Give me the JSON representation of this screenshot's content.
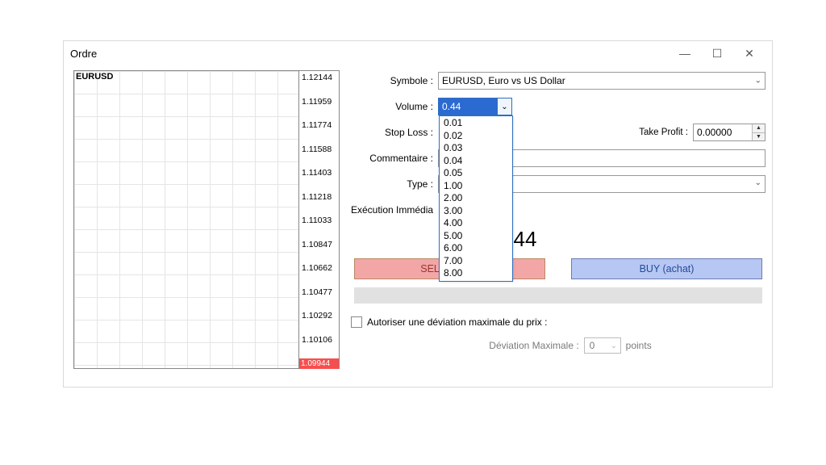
{
  "window": {
    "title": "Ordre"
  },
  "chart": {
    "symbol": "EURUSD",
    "ticks": [
      "1.12144",
      "1.11959",
      "1.11774",
      "1.11588",
      "1.11403",
      "1.11218",
      "1.11033",
      "1.10847",
      "1.10662",
      "1.10477",
      "1.10292",
      "1.10106"
    ],
    "current": "1.09944"
  },
  "form": {
    "labels": {
      "symbole": "Symbole :",
      "volume": "Volume :",
      "stoploss": "Stop Loss :",
      "takeprofit": "Take Profit :",
      "commentaire": "Commentaire :",
      "type": "Type :",
      "execution": "Exécution Immédia"
    },
    "symbole_value": "EURUSD, Euro vs US Dollar",
    "volume_value": "0.44",
    "volume_options": [
      "0.01",
      "0.02",
      "0.03",
      "0.04",
      "0.05",
      "1.00",
      "2.00",
      "3.00",
      "4.00",
      "5.00",
      "6.00",
      "7.00",
      "8.00"
    ],
    "stoploss_value": "",
    "takeprofit_value": "0.00000",
    "price_display": "/ 1.09944",
    "sell_label": "SELL (vente)",
    "buy_label": "BUY (achat)",
    "allow_deviation_label": "Autoriser une déviation maximale du prix :",
    "deviation_label": "Déviation Maximale :",
    "deviation_value": "0",
    "deviation_unit": "points"
  }
}
